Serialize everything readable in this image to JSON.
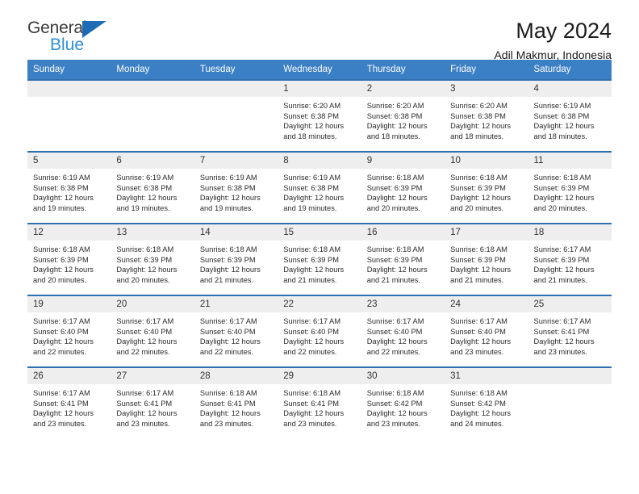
{
  "brand": {
    "name_top": "General",
    "name_bottom": "Blue",
    "triangle_color": "#1d6cb5",
    "blue_color": "#2b8fd6"
  },
  "header": {
    "title": "May 2024",
    "subtitle": "Adil Makmur, Indonesia"
  },
  "theme": {
    "header_bg": "#3b7fc4",
    "row_border": "#2f6fae",
    "daynum_bg": "#eeeeee"
  },
  "weekdays": [
    "Sunday",
    "Monday",
    "Tuesday",
    "Wednesday",
    "Thursday",
    "Friday",
    "Saturday"
  ],
  "labels": {
    "sunrise_prefix": "Sunrise:",
    "sunset_prefix": "Sunset:",
    "daylight_prefix": "Daylight:"
  },
  "weeks": [
    [
      {
        "day": "",
        "empty": true
      },
      {
        "day": "",
        "empty": true
      },
      {
        "day": "",
        "empty": true
      },
      {
        "day": "1",
        "sunrise": "Sunrise: 6:20 AM",
        "sunset": "Sunset: 6:38 PM",
        "daylight1": "Daylight: 12 hours",
        "daylight2": "and 18 minutes."
      },
      {
        "day": "2",
        "sunrise": "Sunrise: 6:20 AM",
        "sunset": "Sunset: 6:38 PM",
        "daylight1": "Daylight: 12 hours",
        "daylight2": "and 18 minutes."
      },
      {
        "day": "3",
        "sunrise": "Sunrise: 6:20 AM",
        "sunset": "Sunset: 6:38 PM",
        "daylight1": "Daylight: 12 hours",
        "daylight2": "and 18 minutes."
      },
      {
        "day": "4",
        "sunrise": "Sunrise: 6:19 AM",
        "sunset": "Sunset: 6:38 PM",
        "daylight1": "Daylight: 12 hours",
        "daylight2": "and 18 minutes."
      }
    ],
    [
      {
        "day": "5",
        "sunrise": "Sunrise: 6:19 AM",
        "sunset": "Sunset: 6:38 PM",
        "daylight1": "Daylight: 12 hours",
        "daylight2": "and 19 minutes."
      },
      {
        "day": "6",
        "sunrise": "Sunrise: 6:19 AM",
        "sunset": "Sunset: 6:38 PM",
        "daylight1": "Daylight: 12 hours",
        "daylight2": "and 19 minutes."
      },
      {
        "day": "7",
        "sunrise": "Sunrise: 6:19 AM",
        "sunset": "Sunset: 6:38 PM",
        "daylight1": "Daylight: 12 hours",
        "daylight2": "and 19 minutes."
      },
      {
        "day": "8",
        "sunrise": "Sunrise: 6:19 AM",
        "sunset": "Sunset: 6:38 PM",
        "daylight1": "Daylight: 12 hours",
        "daylight2": "and 19 minutes."
      },
      {
        "day": "9",
        "sunrise": "Sunrise: 6:18 AM",
        "sunset": "Sunset: 6:39 PM",
        "daylight1": "Daylight: 12 hours",
        "daylight2": "and 20 minutes."
      },
      {
        "day": "10",
        "sunrise": "Sunrise: 6:18 AM",
        "sunset": "Sunset: 6:39 PM",
        "daylight1": "Daylight: 12 hours",
        "daylight2": "and 20 minutes."
      },
      {
        "day": "11",
        "sunrise": "Sunrise: 6:18 AM",
        "sunset": "Sunset: 6:39 PM",
        "daylight1": "Daylight: 12 hours",
        "daylight2": "and 20 minutes."
      }
    ],
    [
      {
        "day": "12",
        "sunrise": "Sunrise: 6:18 AM",
        "sunset": "Sunset: 6:39 PM",
        "daylight1": "Daylight: 12 hours",
        "daylight2": "and 20 minutes."
      },
      {
        "day": "13",
        "sunrise": "Sunrise: 6:18 AM",
        "sunset": "Sunset: 6:39 PM",
        "daylight1": "Daylight: 12 hours",
        "daylight2": "and 20 minutes."
      },
      {
        "day": "14",
        "sunrise": "Sunrise: 6:18 AM",
        "sunset": "Sunset: 6:39 PM",
        "daylight1": "Daylight: 12 hours",
        "daylight2": "and 21 minutes."
      },
      {
        "day": "15",
        "sunrise": "Sunrise: 6:18 AM",
        "sunset": "Sunset: 6:39 PM",
        "daylight1": "Daylight: 12 hours",
        "daylight2": "and 21 minutes."
      },
      {
        "day": "16",
        "sunrise": "Sunrise: 6:18 AM",
        "sunset": "Sunset: 6:39 PM",
        "daylight1": "Daylight: 12 hours",
        "daylight2": "and 21 minutes."
      },
      {
        "day": "17",
        "sunrise": "Sunrise: 6:18 AM",
        "sunset": "Sunset: 6:39 PM",
        "daylight1": "Daylight: 12 hours",
        "daylight2": "and 21 minutes."
      },
      {
        "day": "18",
        "sunrise": "Sunrise: 6:17 AM",
        "sunset": "Sunset: 6:39 PM",
        "daylight1": "Daylight: 12 hours",
        "daylight2": "and 21 minutes."
      }
    ],
    [
      {
        "day": "19",
        "sunrise": "Sunrise: 6:17 AM",
        "sunset": "Sunset: 6:40 PM",
        "daylight1": "Daylight: 12 hours",
        "daylight2": "and 22 minutes."
      },
      {
        "day": "20",
        "sunrise": "Sunrise: 6:17 AM",
        "sunset": "Sunset: 6:40 PM",
        "daylight1": "Daylight: 12 hours",
        "daylight2": "and 22 minutes."
      },
      {
        "day": "21",
        "sunrise": "Sunrise: 6:17 AM",
        "sunset": "Sunset: 6:40 PM",
        "daylight1": "Daylight: 12 hours",
        "daylight2": "and 22 minutes."
      },
      {
        "day": "22",
        "sunrise": "Sunrise: 6:17 AM",
        "sunset": "Sunset: 6:40 PM",
        "daylight1": "Daylight: 12 hours",
        "daylight2": "and 22 minutes."
      },
      {
        "day": "23",
        "sunrise": "Sunrise: 6:17 AM",
        "sunset": "Sunset: 6:40 PM",
        "daylight1": "Daylight: 12 hours",
        "daylight2": "and 22 minutes."
      },
      {
        "day": "24",
        "sunrise": "Sunrise: 6:17 AM",
        "sunset": "Sunset: 6:40 PM",
        "daylight1": "Daylight: 12 hours",
        "daylight2": "and 23 minutes."
      },
      {
        "day": "25",
        "sunrise": "Sunrise: 6:17 AM",
        "sunset": "Sunset: 6:41 PM",
        "daylight1": "Daylight: 12 hours",
        "daylight2": "and 23 minutes."
      }
    ],
    [
      {
        "day": "26",
        "sunrise": "Sunrise: 6:17 AM",
        "sunset": "Sunset: 6:41 PM",
        "daylight1": "Daylight: 12 hours",
        "daylight2": "and 23 minutes."
      },
      {
        "day": "27",
        "sunrise": "Sunrise: 6:17 AM",
        "sunset": "Sunset: 6:41 PM",
        "daylight1": "Daylight: 12 hours",
        "daylight2": "and 23 minutes."
      },
      {
        "day": "28",
        "sunrise": "Sunrise: 6:18 AM",
        "sunset": "Sunset: 6:41 PM",
        "daylight1": "Daylight: 12 hours",
        "daylight2": "and 23 minutes."
      },
      {
        "day": "29",
        "sunrise": "Sunrise: 6:18 AM",
        "sunset": "Sunset: 6:41 PM",
        "daylight1": "Daylight: 12 hours",
        "daylight2": "and 23 minutes."
      },
      {
        "day": "30",
        "sunrise": "Sunrise: 6:18 AM",
        "sunset": "Sunset: 6:42 PM",
        "daylight1": "Daylight: 12 hours",
        "daylight2": "and 23 minutes."
      },
      {
        "day": "31",
        "sunrise": "Sunrise: 6:18 AM",
        "sunset": "Sunset: 6:42 PM",
        "daylight1": "Daylight: 12 hours",
        "daylight2": "and 24 minutes."
      },
      {
        "day": "",
        "empty": true
      }
    ]
  ]
}
